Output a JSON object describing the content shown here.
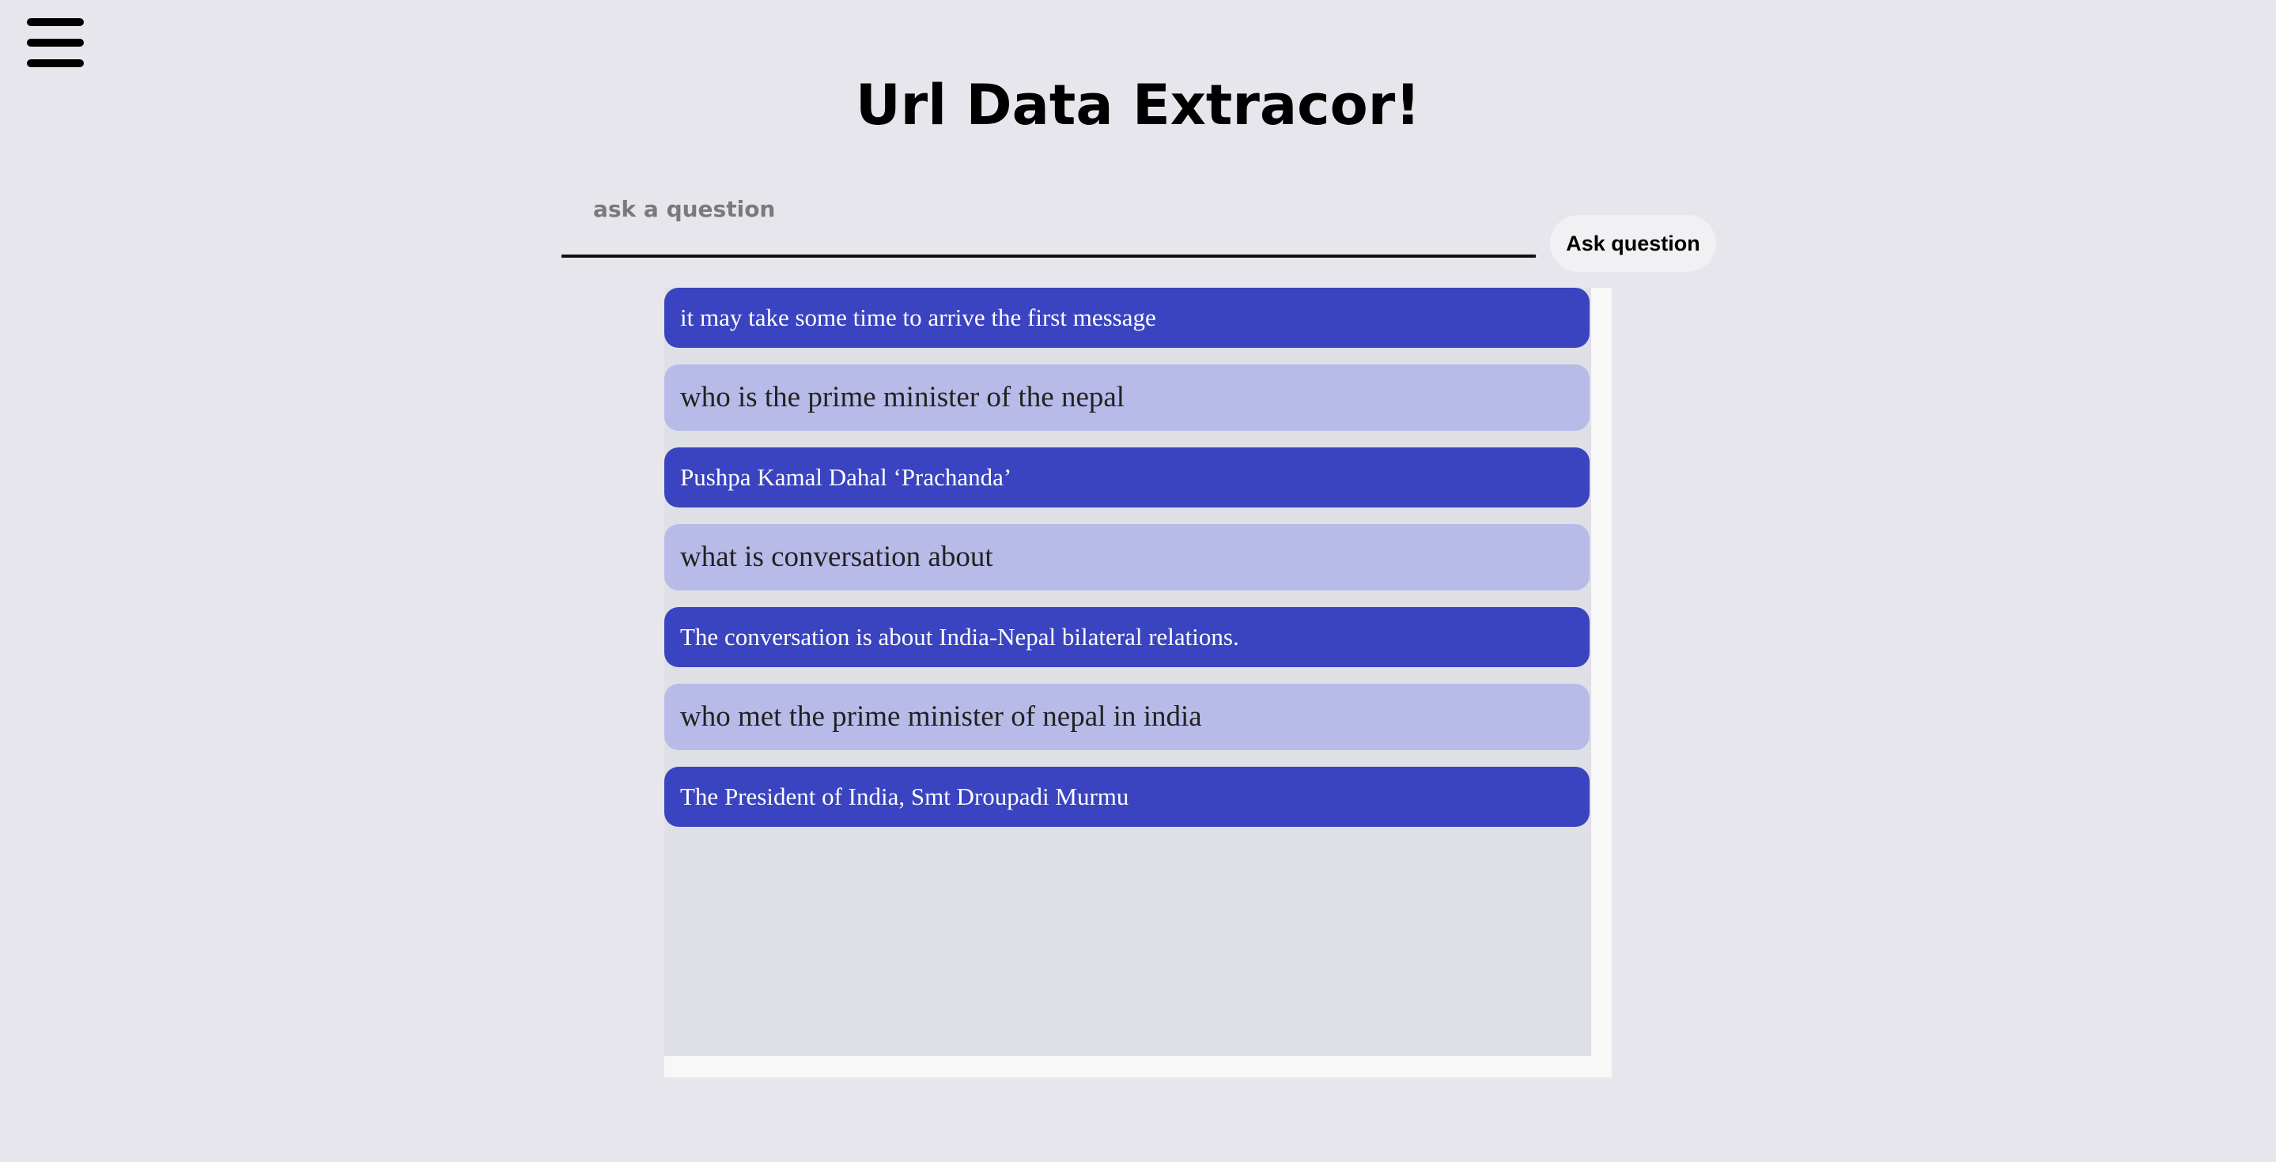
{
  "header": {
    "menu_icon": "hamburger-menu-icon",
    "title": "Url Data Extracor!"
  },
  "search": {
    "placeholder": "ask a question",
    "value": "",
    "button_label": "Ask question"
  },
  "chat": {
    "messages": [
      {
        "role": "bot",
        "text": "it may take some time to arrive the first message"
      },
      {
        "role": "user",
        "text": "who is the prime minister of the nepal"
      },
      {
        "role": "bot",
        "text": "Pushpa Kamal Dahal ‘Prachanda’"
      },
      {
        "role": "user",
        "text": "what is conversation about"
      },
      {
        "role": "bot",
        "text": "The conversation is about India-Nepal bilateral relations."
      },
      {
        "role": "user",
        "text": "who met the prime minister of nepal in india"
      },
      {
        "role": "bot",
        "text": "The President of India, Smt Droupadi Murmu"
      }
    ]
  },
  "colors": {
    "background": "#e7e6ec",
    "bot_bubble": "#3a43c0",
    "user_bubble": "#b8bbe8",
    "chat_area": "#dfe0e6"
  }
}
